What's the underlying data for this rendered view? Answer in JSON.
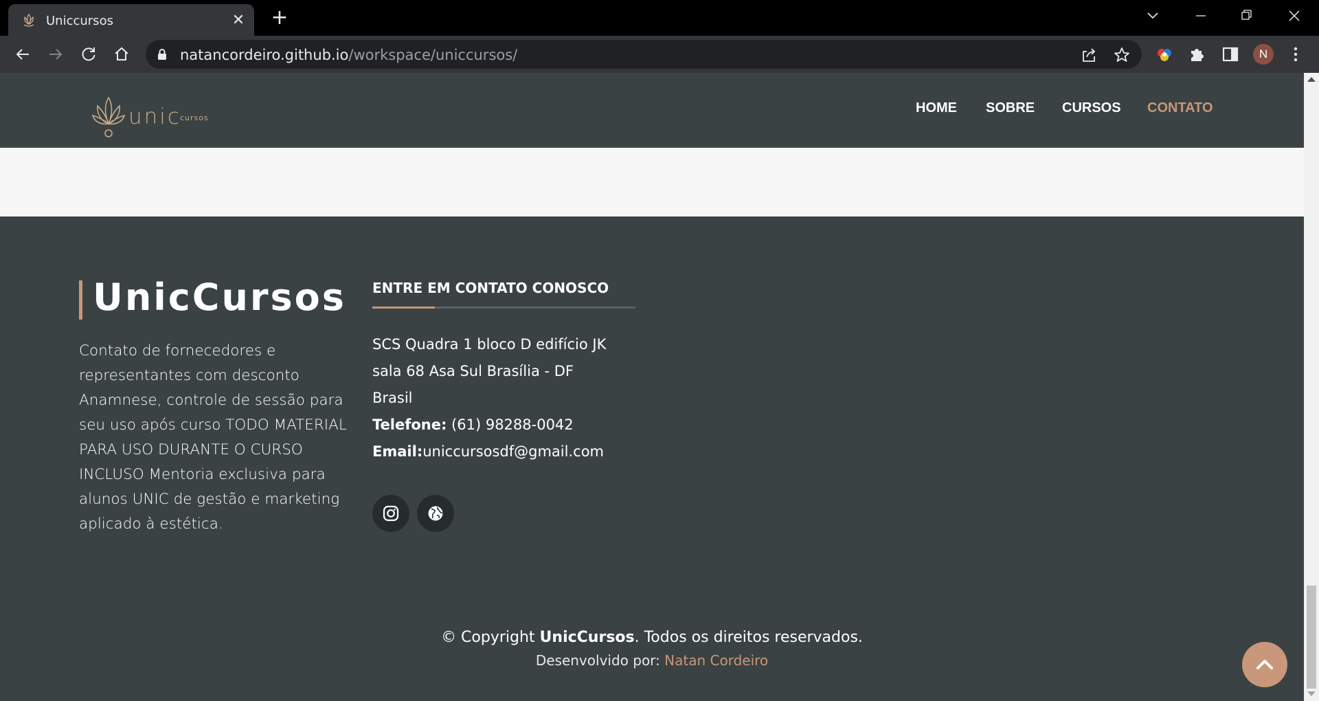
{
  "browser": {
    "tab_title": "Uniccursos",
    "url_host": "natancordeiro.github.io",
    "url_path": "/workspace/uniccursos/",
    "profile_initial": "N"
  },
  "header": {
    "logo_word": "unic",
    "logo_small": "cursos",
    "nav": [
      "HOME",
      "SOBRE",
      "CURSOS",
      "CONTATO"
    ],
    "active_nav": "CONTATO"
  },
  "footer": {
    "brand": "UnicCursos",
    "about": "Contato de fornecedores e representantes com desconto Anamnese, controle de sessão para seu uso após curso TODO MATERIAL PARA USO DURANTE O CURSO INCLUSO Mentoria exclusiva para alunos UNIC de gestão e marketing aplicado à estética.",
    "contact_title": "ENTRE EM CONTATO CONOSCO",
    "address_line1": "SCS Quadra 1 bloco D edifício JK",
    "address_line2": "sala 68 Asa Sul Brasília - DF",
    "address_line3": "Brasil",
    "phone_label": "Telefone:",
    "phone": " (61) 98288-0042",
    "email_label": "Email:",
    "email": "uniccursosdf@gmail.com",
    "copyright_prefix": "© Copyright ",
    "copyright_brand": "UnicCursos",
    "copyright_suffix": ". Todos os direitos reservados.",
    "dev_label": "Desenvolvido por: ",
    "dev_name": "Natan Cordeiro"
  },
  "colors": {
    "dark": "#3a4243",
    "accent": "#c9977a",
    "light_band": "#f7f7f7"
  }
}
